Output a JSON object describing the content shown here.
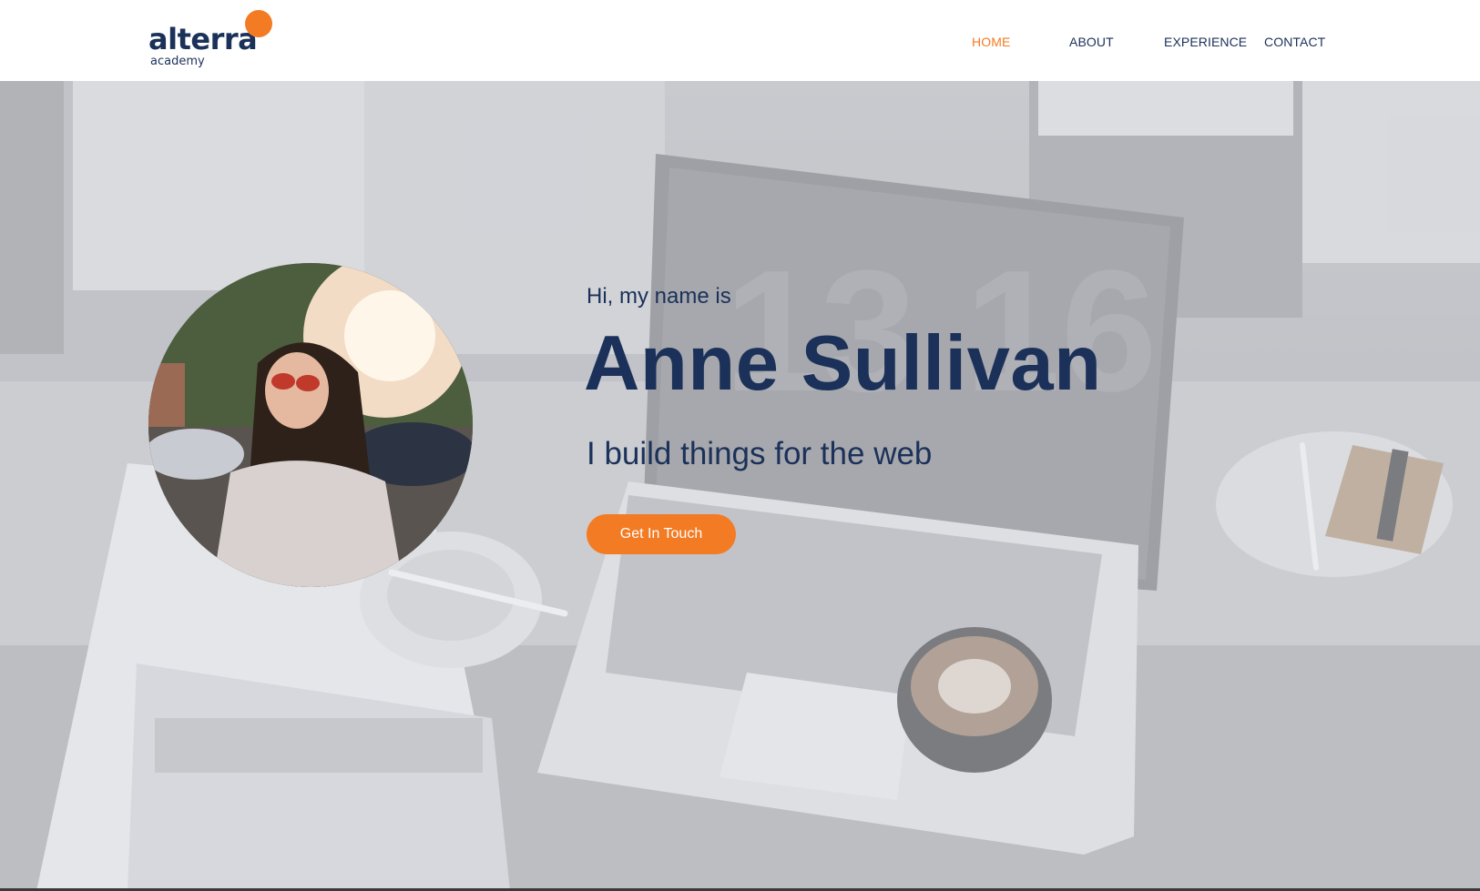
{
  "brand": {
    "name": "alterra",
    "subtitle": "academy",
    "accent_color": "#f37b23",
    "primary_color": "#1b3159"
  },
  "nav": {
    "items": [
      {
        "label": "HOME",
        "active": true
      },
      {
        "label": "ABOUT",
        "active": false
      },
      {
        "label": "EXPERIENCE",
        "active": false
      },
      {
        "label": "CONTACT",
        "active": false
      }
    ]
  },
  "hero": {
    "greeting": "Hi, my name is",
    "name": "Anne Sullivan",
    "tagline": "I build things for the web",
    "cta_label": "Get In Touch",
    "laptop_screen_numbers": "13 16",
    "background": "desk-with-laptop-coffee-magazine-photo",
    "profile_photo": "woman-in-sunglasses-portrait-photo"
  }
}
